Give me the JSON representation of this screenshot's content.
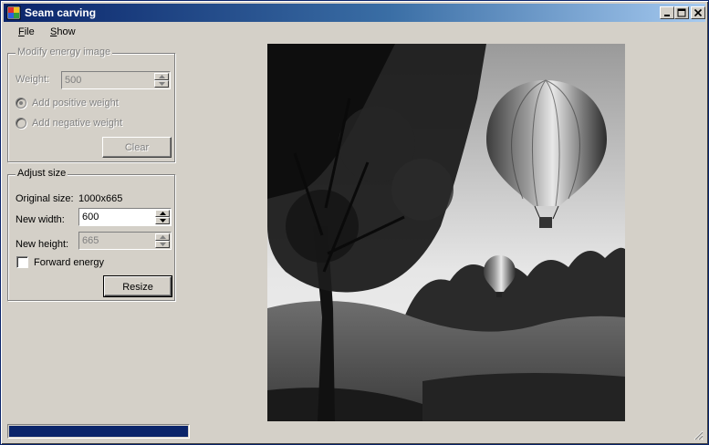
{
  "window": {
    "title": "Seam carving",
    "controls": {
      "minimize_icon": "minimize-icon",
      "maximize_icon": "maximize-icon",
      "close_icon": "close-icon"
    }
  },
  "menu": [
    {
      "label": "File",
      "accel": "F",
      "rest": "ile"
    },
    {
      "label": "Show",
      "accel": "S",
      "rest": "how"
    }
  ],
  "energy_group": {
    "title": "Modify energy image",
    "weight_label": "Weight:",
    "weight_value": "500",
    "add_positive_label": "Add positive weight",
    "add_negative_label": "Add negative weight",
    "clear_label": "Clear",
    "enabled": false
  },
  "size_group": {
    "title": "Adjust size",
    "original_size_label": "Original size:",
    "original_size_value": "1000x665",
    "new_width_label": "New width:",
    "new_width_value": "600",
    "new_height_label": "New height:",
    "new_height_value": "665",
    "forward_energy_label": "Forward energy",
    "forward_energy_checked": false,
    "resize_label": "Resize"
  },
  "image": {
    "description_icon": "photo-grayscale-balloons"
  },
  "status": {
    "progress": 1.0
  },
  "colors": {
    "titlebar_start": "#0a246a",
    "titlebar_end": "#a6caf0",
    "face": "#d4d0c8",
    "progress_fill": "#0a246a"
  }
}
